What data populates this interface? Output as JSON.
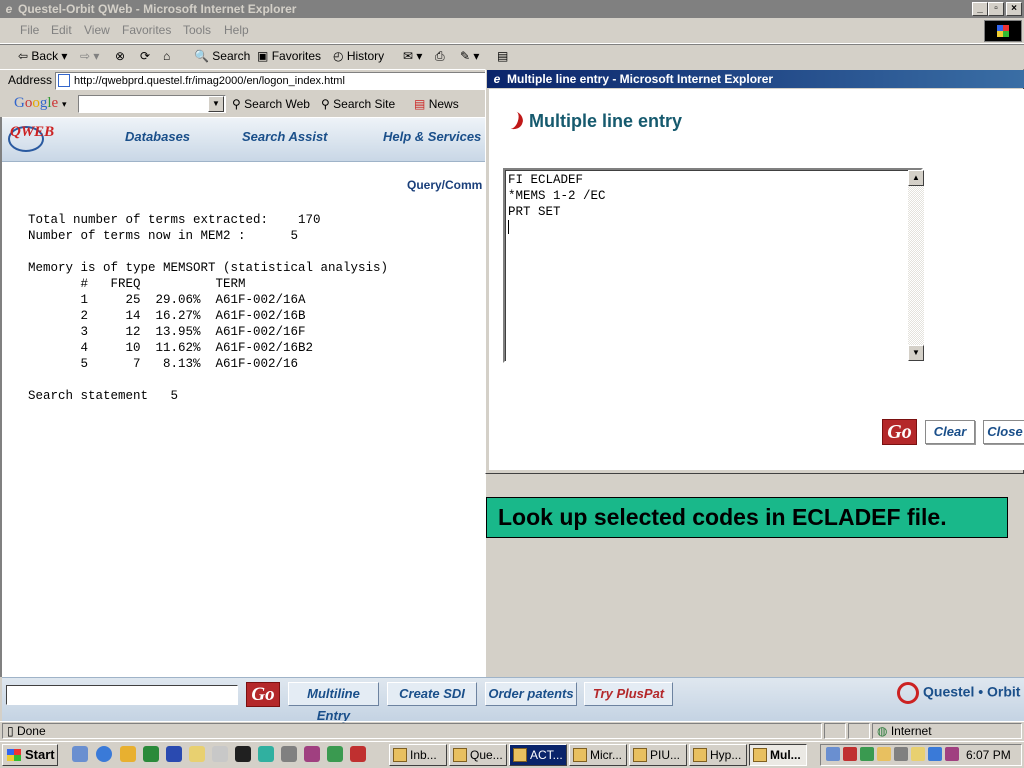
{
  "main_window": {
    "title": "Questel-Orbit QWeb - Microsoft Internet Explorer",
    "menu": [
      "File",
      "Edit",
      "View",
      "Favorites",
      "Tools",
      "Help"
    ],
    "toolbar": {
      "back": "Back",
      "search": "Search",
      "favorites": "Favorites",
      "history": "History"
    },
    "address_label": "Address",
    "address_url": "http://qwebprd.questel.fr/imag2000/en/logon_index.html",
    "google": {
      "logo": "Google",
      "search_web": "Search Web",
      "search_site": "Search Site",
      "news": "News"
    }
  },
  "qweb": {
    "logo": "QWEB",
    "nav": [
      "Databases",
      "Search Assist",
      "Help & Services"
    ],
    "query_command_link": "Query/Comm",
    "results": {
      "line1": "Total number of terms extracted:    170",
      "line2": "Number of terms now in MEM2 :      5",
      "memory_type": "Memory is of type MEMSORT (statistical analysis)",
      "table_header": "       #   FREQ          TERM",
      "rows": [
        "       1     25  29.06%  A61F-002/16A",
        "       2     14  16.27%  A61F-002/16B",
        "       3     12  13.95%  A61F-002/16F",
        "       4     10  11.62%  A61F-002/16B2",
        "       5      7   8.13%  A61F-002/16"
      ],
      "search_statement": "Search statement   5"
    },
    "bottom": {
      "go": "Go",
      "multiline_entry": "Multiline Entry",
      "create_sdi": "Create SDI",
      "order_patents": "Order patents",
      "try_pluspat": "Try PlusPat",
      "brand": "Questel • Orbit"
    }
  },
  "status": {
    "text": "Done",
    "zone": "Internet"
  },
  "popup": {
    "title": "Multiple line entry - Microsoft Internet Explorer",
    "heading": "Multiple line entry",
    "textarea_content": "FI ECLADEF\n*MEMS 1-2 /EC\nPRT SET",
    "buttons": {
      "go": "Go",
      "clear": "Clear",
      "close": "Close"
    }
  },
  "callout": "Look up selected codes in ECLADEF file.",
  "taskbar": {
    "start": "Start",
    "tasks": [
      "Inb...",
      "Que...",
      "ACT...",
      "Micr...",
      "PIU...",
      "Hyp...",
      "Mul..."
    ],
    "active_task_index": 6,
    "clock": "6:07 PM"
  }
}
